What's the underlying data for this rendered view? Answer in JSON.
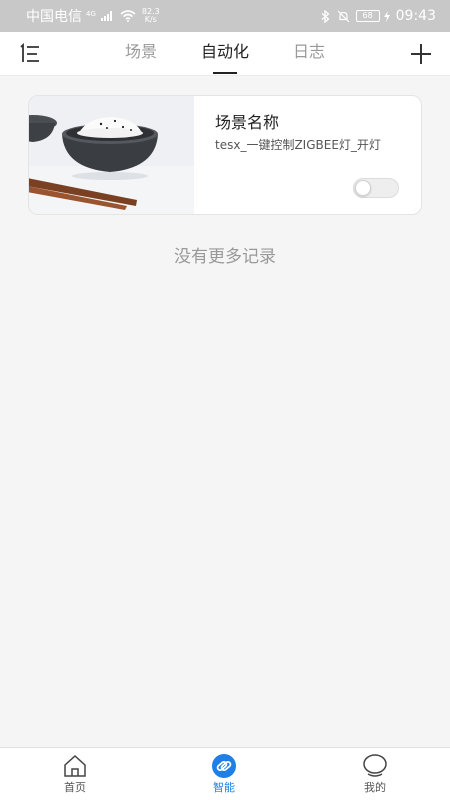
{
  "status_bar": {
    "carrier": "中国电信",
    "network": "4G",
    "net_speed_value": "82.3",
    "net_speed_unit": "K/s",
    "battery": "68",
    "time": "09:43"
  },
  "header": {
    "menu_icon": "menu-list-icon",
    "add_icon": "plus-icon",
    "tabs": [
      {
        "label": "场景"
      },
      {
        "label": "自动化"
      },
      {
        "label": "日志"
      }
    ],
    "active_tab": "自动化"
  },
  "automations": [
    {
      "title": "场景名称",
      "description": "tesx_一键控制ZIGBEE灯_开灯",
      "enabled": false,
      "image": "rice-bowl-with-chopsticks"
    }
  ],
  "empty_state": "没有更多记录",
  "bottom_nav": {
    "items": [
      {
        "label": "首页",
        "icon": "home-icon"
      },
      {
        "label": "智能",
        "icon": "smart-link-icon"
      },
      {
        "label": "我的",
        "icon": "profile-icon"
      }
    ],
    "active": "智能",
    "active_color": "#1e7fe6"
  }
}
